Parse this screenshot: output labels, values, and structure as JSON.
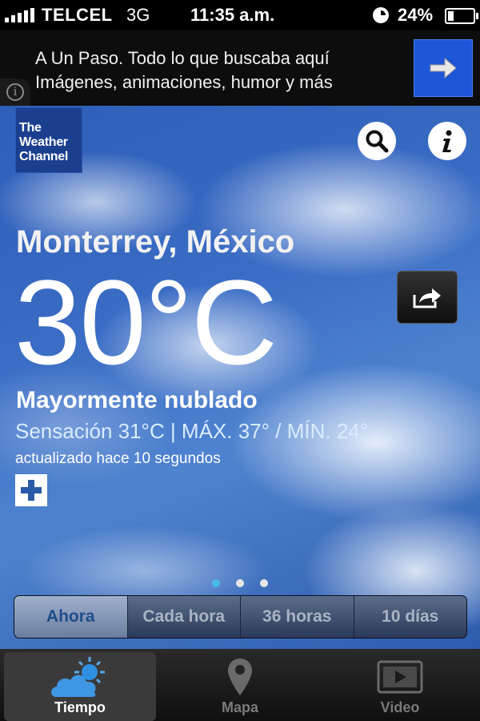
{
  "status_bar": {
    "carrier": "TELCEL",
    "network": "3G",
    "time": "11:35 a.m.",
    "battery_percent": "24%",
    "battery_level": 0.24
  },
  "ad": {
    "line1": "A Un Paso. Todo lo que buscaba aquí",
    "line2": "Imágenes, animaciones, humor y más"
  },
  "logo": {
    "text": "The\nWeather\nChannel"
  },
  "weather": {
    "location": "Monterrey, México",
    "temperature": "30°C",
    "condition": "Mayormente nublado",
    "details": "Sensación 31°C | MÁX. 37° / MÍN. 24°",
    "updated": "actualizado hace 10 segundos"
  },
  "pager": {
    "count": 3,
    "active_index": 0
  },
  "segments": [
    {
      "label": "Ahora"
    },
    {
      "label": "Cada hora"
    },
    {
      "label": "36 horas"
    },
    {
      "label": "10 días"
    }
  ],
  "tabs": [
    {
      "label": "Tiempo",
      "icon": "weather-cloud-sun-icon",
      "active": true
    },
    {
      "label": "Mapa",
      "icon": "map-pin-icon",
      "active": false
    },
    {
      "label": "Video",
      "icon": "video-play-icon",
      "active": false
    }
  ],
  "colors": {
    "accent_blue": "#1d57d8",
    "logo_blue": "#1b3f8f",
    "details_text": "#d9ecff",
    "page_dot_active": "#48b9e8"
  }
}
